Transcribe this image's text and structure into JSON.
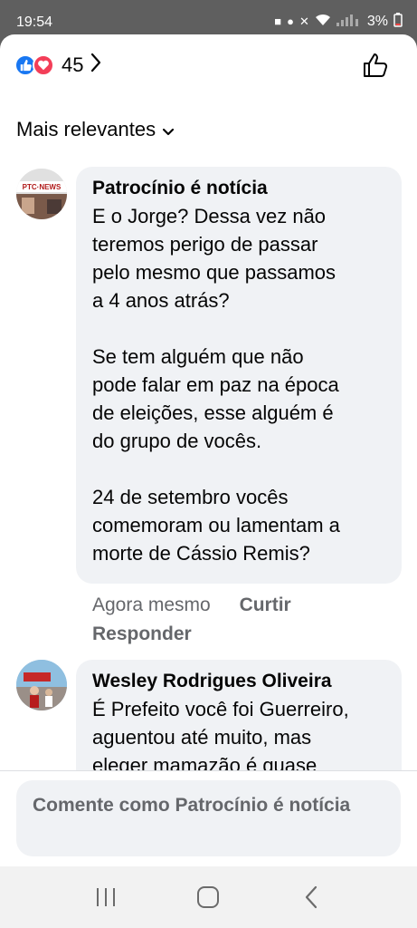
{
  "status": {
    "time": "19:54",
    "battery": "3%"
  },
  "reactions": {
    "count": "45"
  },
  "sort": {
    "label": "Mais relevantes"
  },
  "comments": [
    {
      "author": "Patrocínio é notícia",
      "avatar_text": "PTC·NEWS",
      "text": "E o Jorge? Dessa vez não\nteremos perigo de passar\npelo mesmo que passamos\na 4 anos atrás?\n\nSe tem alguém que não\npode falar em paz na época\nde eleições, esse alguém é\ndo grupo de vocês.\n\n24 de setembro vocês\ncomemoram ou lamentam a\nmorte de Cássio Remis?",
      "time": "Agora mesmo",
      "like_label": "Curtir",
      "reply_label": "Responder"
    },
    {
      "author": "Wesley Rodrigues Oliveira",
      "text": "É Prefeito você foi Guerreiro,\naguentou até muito, mas\neleger mamazão é quase"
    }
  ],
  "composer": {
    "placeholder": "Comente como Patrocínio é notícia"
  },
  "colors": {
    "like_blue": "#1877f2",
    "love_red": "#f33e58",
    "bubble": "#f0f2f5",
    "secondary_text": "#65676b"
  }
}
